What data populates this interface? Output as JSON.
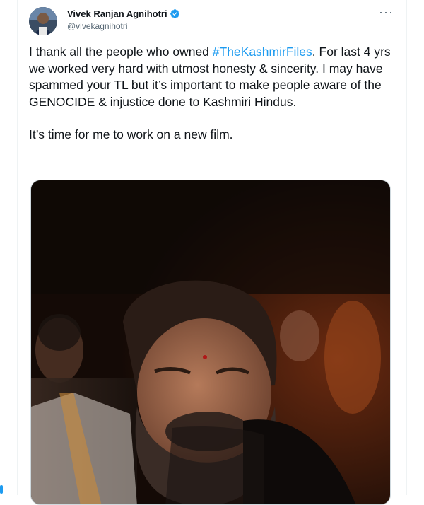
{
  "tweet": {
    "author": {
      "display_name": "Vivek Ranjan Agnihotri",
      "handle": "@vivekagnihotri",
      "verified": true,
      "avatar_icon": "profile-photo"
    },
    "more_icon": "more-options-icon",
    "body": {
      "line1_prefix": "I thank all the people who owned ",
      "hashtag": "#TheKashmirFiles",
      "line1_suffix": ".",
      "paragraph1_rest": "For last 4 yrs we worked very hard with utmost honesty & sincerity. I may have spammed your TL but it’s important to make people aware of the GENOCIDE & injustice done to Kashmiri Hindus.",
      "paragraph2": "It’s time for me to work on a new film."
    },
    "media": {
      "type": "photo"
    }
  },
  "colors": {
    "accent": "#1d9bf0",
    "text": "#0f1419",
    "secondary_text": "#536471"
  }
}
